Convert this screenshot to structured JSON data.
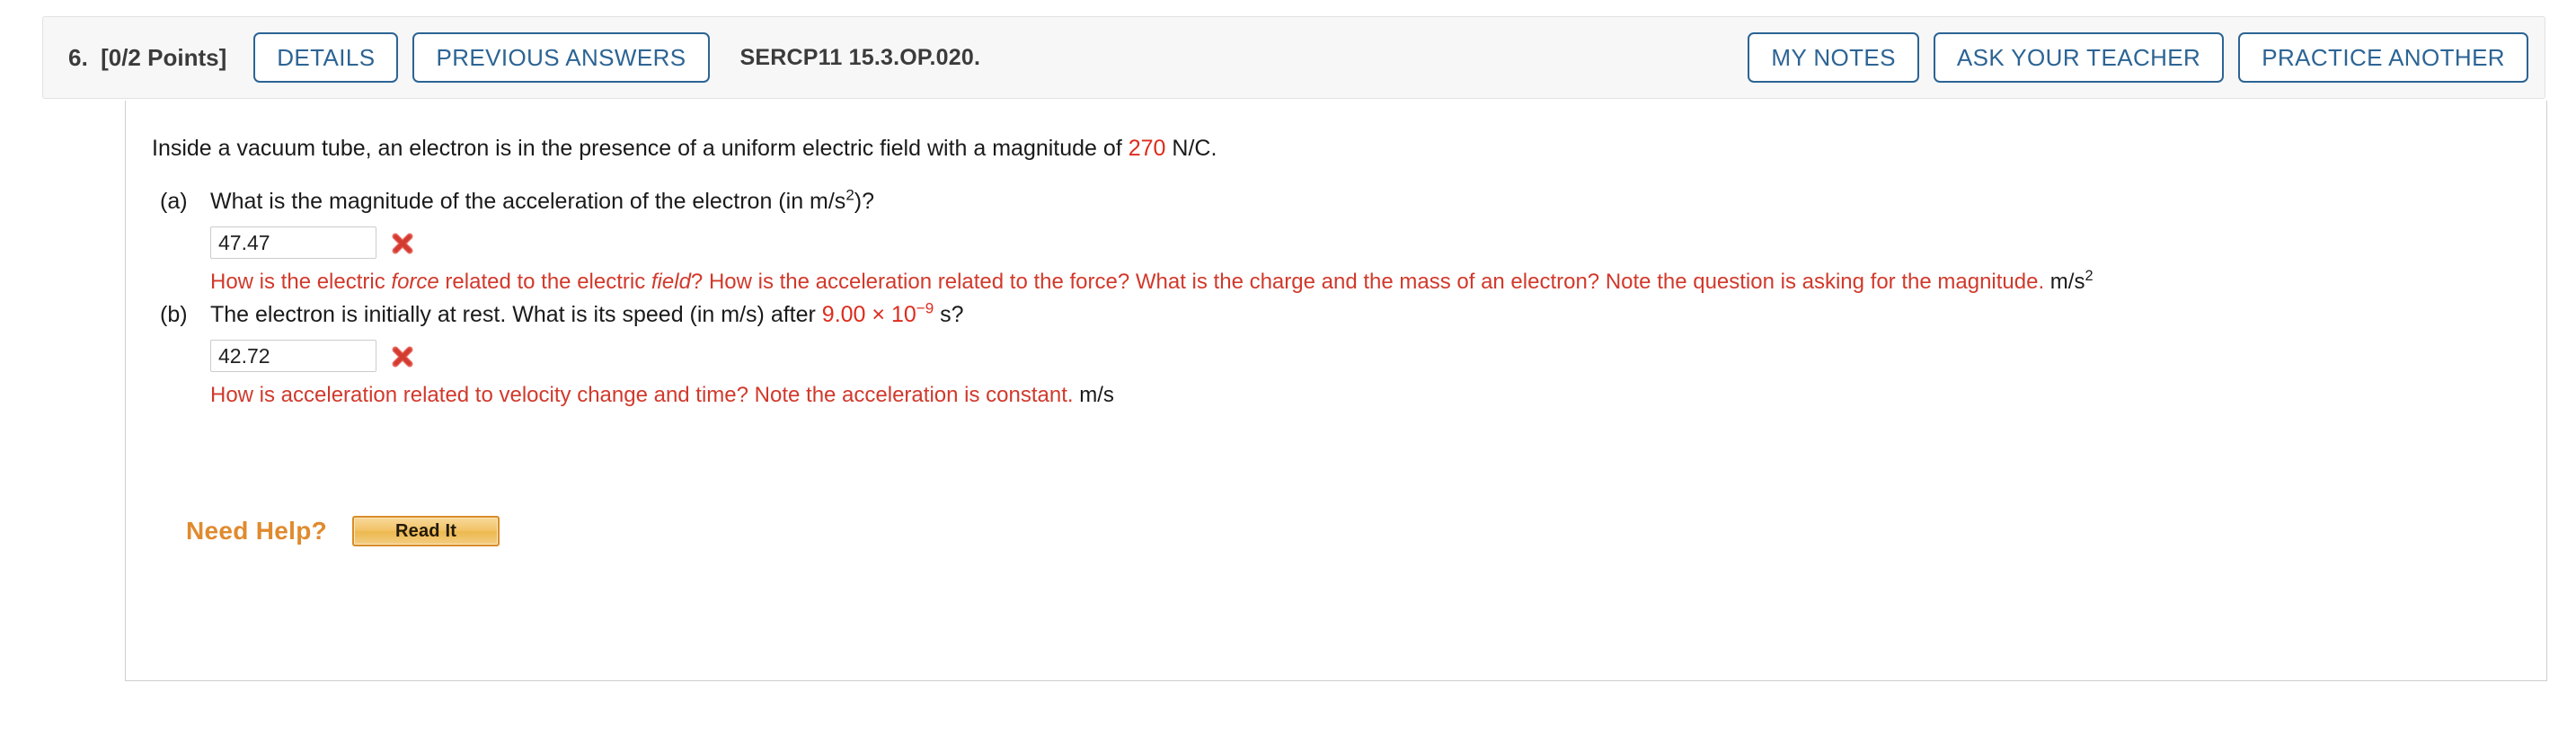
{
  "header": {
    "question_number": "6.",
    "points": "[0/2 Points]",
    "details_label": "DETAILS",
    "previous_answers_label": "PREVIOUS ANSWERS",
    "problem_code": "SERCP11 15.3.OP.020.",
    "my_notes_label": "MY NOTES",
    "ask_your_teacher_label": "ASK YOUR TEACHER",
    "practice_another_label": "PRACTICE ANOTHER"
  },
  "question": {
    "stem_before_value": "Inside a vacuum tube, an electron is in the presence of a uniform electric field with a magnitude of ",
    "stem_value": "270",
    "stem_after_value": " N/C."
  },
  "parts": [
    {
      "label": "(a)",
      "question_text_1": "What is the magnitude of the acceleration of the electron (in m/s",
      "question_exponent": "2",
      "question_text_2": ")?",
      "answer_value": "47.47",
      "status_icon": "incorrect-x-icon",
      "feedback_1": "How is the electric ",
      "feedback_italic_1": "force",
      "feedback_2": " related to the electric ",
      "feedback_italic_2": "field",
      "feedback_3": "? How is the acceleration related to the force? What is the charge and the mass of an electron? Note the question is asking for the magnitude.",
      "unit_text": "m/s",
      "unit_exponent": "2"
    },
    {
      "label": "(b)",
      "question_text_1": "The electron is initially at rest. What is its speed (in m/s) after ",
      "question_value_mantissa": "9.00 × 10",
      "question_value_exponent": "−9",
      "question_text_2": " s?",
      "answer_value": "42.72",
      "status_icon": "incorrect-x-icon",
      "feedback_1": "How is acceleration related to velocity change and time? Note the acceleration is constant.",
      "unit_text": "m/s"
    }
  ],
  "need_help": {
    "label": "Need Help?",
    "read_it_label": "Read It"
  },
  "colors": {
    "accent_blue": "#2c6494",
    "value_red": "#dd2c1c",
    "feedback_red": "#d1392b",
    "need_help_orange": "#e08a2e",
    "header_bg": "#f7f7f7"
  }
}
